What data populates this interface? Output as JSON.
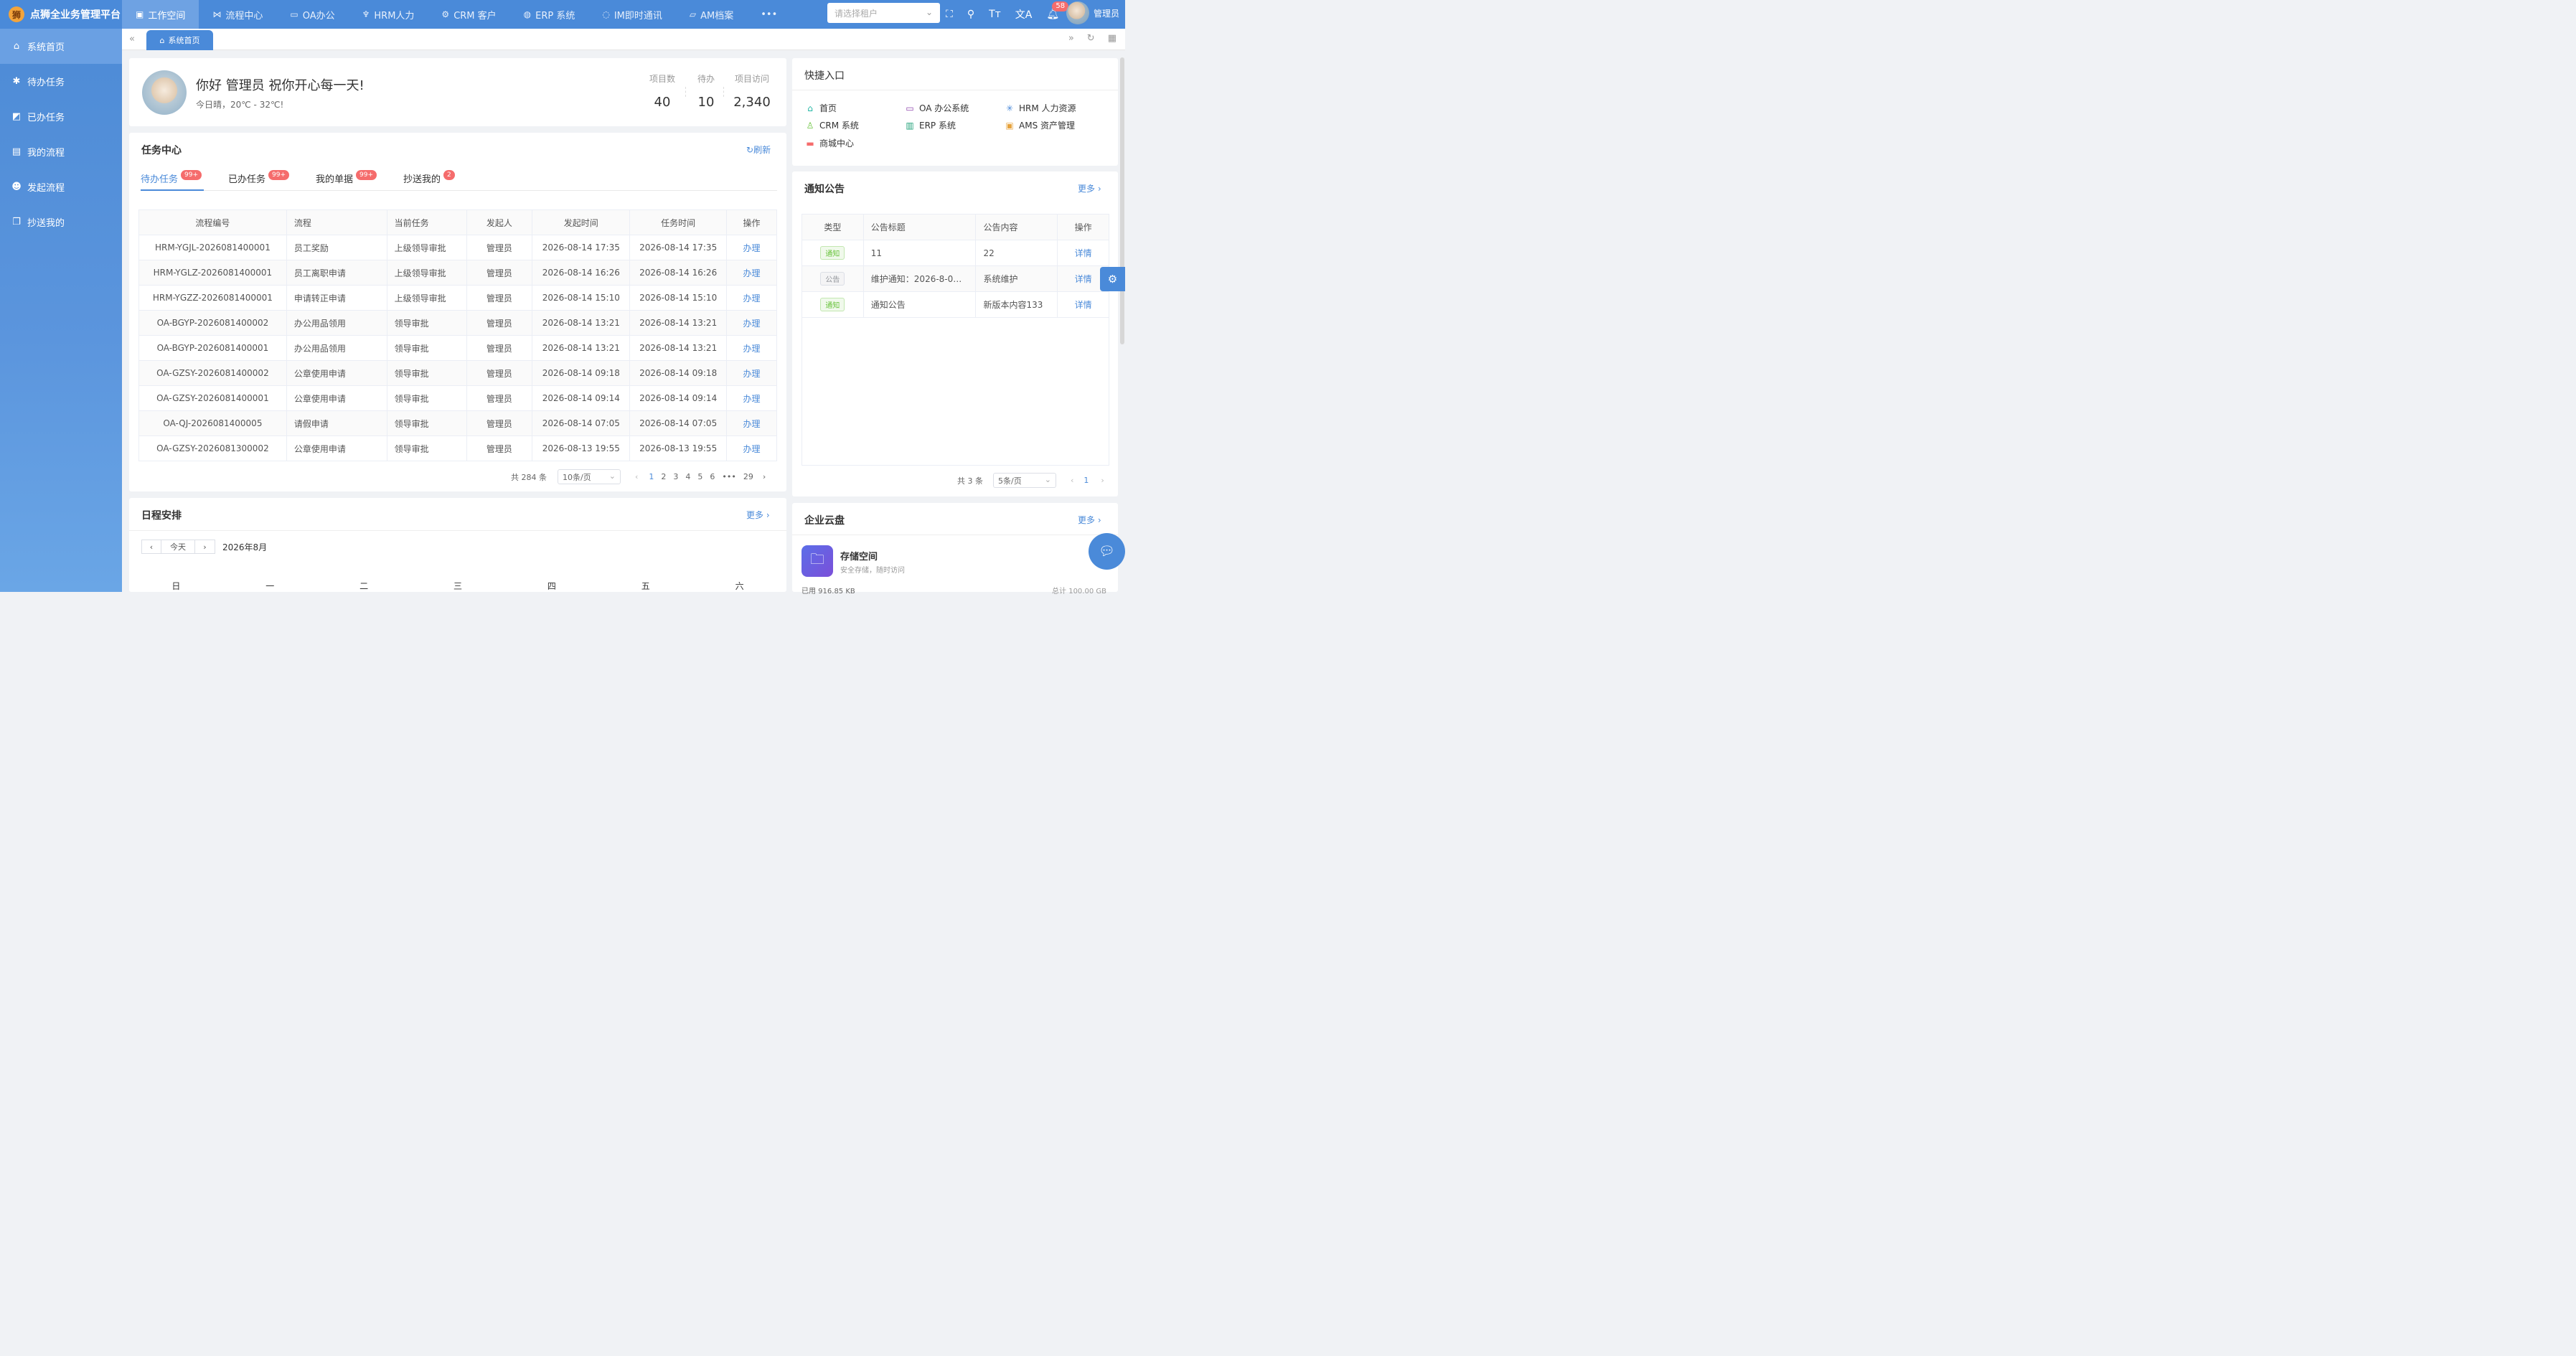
{
  "app": {
    "title": "点狮全业务管理平台",
    "logo_glyph": "狮"
  },
  "topnav": [
    {
      "label": "工作空间",
      "icon": "twitter-icon",
      "glyph": "▣",
      "active": true
    },
    {
      "label": "流程中心",
      "icon": "flow-icon",
      "glyph": "⋈"
    },
    {
      "label": "OA办公",
      "icon": "monitor-icon",
      "glyph": "▭"
    },
    {
      "label": "HRM人力",
      "icon": "person-icon",
      "glyph": "♆"
    },
    {
      "label": "CRM 客户",
      "icon": "gear-icon",
      "glyph": "⚙"
    },
    {
      "label": "ERP 系统",
      "icon": "globe-icon",
      "glyph": "◍"
    },
    {
      "label": "IM即时通讯",
      "icon": "chat-icon",
      "glyph": "◌"
    },
    {
      "label": "AM档案",
      "icon": "folder-icon",
      "glyph": "▱"
    }
  ],
  "more_glyph": "•••",
  "tenant": {
    "placeholder": "请选择租户"
  },
  "notification_count": "58",
  "user": {
    "name": "管理员"
  },
  "sidebar": [
    {
      "label": "系统首页",
      "icon": "home-icon",
      "glyph": "⌂",
      "active": true
    },
    {
      "label": "待办任务",
      "icon": "gear-icon",
      "glyph": "✱"
    },
    {
      "label": "已办任务",
      "icon": "grid-icon",
      "glyph": "◩"
    },
    {
      "label": "我的流程",
      "icon": "book-icon",
      "glyph": "▤"
    },
    {
      "label": "发起流程",
      "icon": "smile-icon",
      "glyph": "☻"
    },
    {
      "label": "抄送我的",
      "icon": "copy-icon",
      "glyph": "❐"
    }
  ],
  "tabs": {
    "home": "系统首页"
  },
  "greeting": {
    "title": "你好 管理员 祝你开心每一天!",
    "weather": "今日晴，20℃ - 32℃!",
    "stats": [
      {
        "label": "项目数",
        "value": "40"
      },
      {
        "label": "待办",
        "value": "10"
      },
      {
        "label": "项目访问",
        "value": "2,340"
      }
    ]
  },
  "task_center": {
    "title": "任务中心",
    "refresh": "刷新",
    "tabs": [
      {
        "label": "待办任务",
        "badge": "99+",
        "active": true
      },
      {
        "label": "已办任务",
        "badge": "99+"
      },
      {
        "label": "我的单据",
        "badge": "99+"
      },
      {
        "label": "抄送我的",
        "badge": "2"
      }
    ],
    "columns": [
      "流程编号",
      "流程",
      "当前任务",
      "发起人",
      "发起时间",
      "任务时间",
      "操作"
    ],
    "rows": [
      [
        "HRM-YGJL-2026081400001",
        "员工奖励",
        "上级领导审批",
        "管理员",
        "2026-08-14 17:35",
        "2026-08-14 17:35",
        "办理"
      ],
      [
        "HRM-YGLZ-2026081400001",
        "员工离职申请",
        "上级领导审批",
        "管理员",
        "2026-08-14 16:26",
        "2026-08-14 16:26",
        "办理"
      ],
      [
        "HRM-YGZZ-2026081400001",
        "申请转正申请",
        "上级领导审批",
        "管理员",
        "2026-08-14 15:10",
        "2026-08-14 15:10",
        "办理"
      ],
      [
        "OA-BGYP-2026081400002",
        "办公用品领用",
        "领导审批",
        "管理员",
        "2026-08-14 13:21",
        "2026-08-14 13:21",
        "办理"
      ],
      [
        "OA-BGYP-2026081400001",
        "办公用品领用",
        "领导审批",
        "管理员",
        "2026-08-14 13:21",
        "2026-08-14 13:21",
        "办理"
      ],
      [
        "OA-GZSY-2026081400002",
        "公章使用申请",
        "领导审批",
        "管理员",
        "2026-08-14 09:18",
        "2026-08-14 09:18",
        "办理"
      ],
      [
        "OA-GZSY-2026081400001",
        "公章使用申请",
        "领导审批",
        "管理员",
        "2026-08-14 09:14",
        "2026-08-14 09:14",
        "办理"
      ],
      [
        "OA-QJ-2026081400005",
        "请假申请",
        "领导审批",
        "管理员",
        "2026-08-14 07:05",
        "2026-08-14 07:05",
        "办理"
      ],
      [
        "OA-GZSY-2026081300002",
        "公章使用申请",
        "领导审批",
        "管理员",
        "2026-08-13 19:55",
        "2026-08-13 19:55",
        "办理"
      ]
    ],
    "pagination": {
      "total": "共 284 条",
      "page_size": "10条/页",
      "pages": [
        "1",
        "2",
        "3",
        "4",
        "5",
        "6",
        "•••",
        "29"
      ],
      "current": "1"
    }
  },
  "schedule": {
    "title": "日程安排",
    "more": "更多",
    "today": "今天",
    "month": "2026年8月",
    "weekdays": [
      "日",
      "一",
      "二",
      "三",
      "四",
      "五",
      "六"
    ]
  },
  "quick": {
    "title": "快捷入口",
    "items": [
      {
        "label": "首页",
        "icon": "home-icon",
        "glyph": "⌂",
        "color": "#1fb5a3"
      },
      {
        "label": "OA 办公系统",
        "icon": "monitor-icon",
        "glyph": "▭",
        "color": "#8e44ad"
      },
      {
        "label": "HRM 人力资源",
        "icon": "spark-icon",
        "glyph": "✳",
        "color": "#4a8ad9"
      },
      {
        "label": "CRM 系统",
        "icon": "user-icon",
        "glyph": "♙",
        "color": "#67c23a"
      },
      {
        "label": "ERP 系统",
        "icon": "chart-icon",
        "glyph": "▥",
        "color": "#21a179"
      },
      {
        "label": "AMS 资产管理",
        "icon": "briefcase-icon",
        "glyph": "▣",
        "color": "#e6a23c"
      },
      {
        "label": "商城中心",
        "icon": "shop-icon",
        "glyph": "▬",
        "color": "#f56c6c"
      }
    ]
  },
  "notice": {
    "title": "通知公告",
    "more": "更多",
    "columns": [
      "类型",
      "公告标题",
      "公告内容",
      "操作"
    ],
    "rows": [
      {
        "type": "通知",
        "type_style": "green",
        "title": "11",
        "content": "22",
        "op": "详情"
      },
      {
        "type": "公告",
        "type_style": "gray",
        "title": "维护通知：2026-8-0…",
        "content": "系统维护",
        "op": "详情"
      },
      {
        "type": "通知",
        "type_style": "green",
        "title": "通知公告",
        "content": "新版本内容133",
        "op": "详情"
      }
    ],
    "pagination": {
      "total": "共 3 条",
      "page_size": "5条/页",
      "current": "1"
    }
  },
  "cloud": {
    "title": "企业云盘",
    "more": "更多",
    "storage_title": "存储空间",
    "storage_sub": "安全存储，随时访问",
    "used": "已用 916.85 KB",
    "total": "总计 100.00 GB"
  },
  "colors": {
    "primary": "#4a8ad9",
    "badge": "#f56c6c",
    "success": "#67c23a"
  }
}
